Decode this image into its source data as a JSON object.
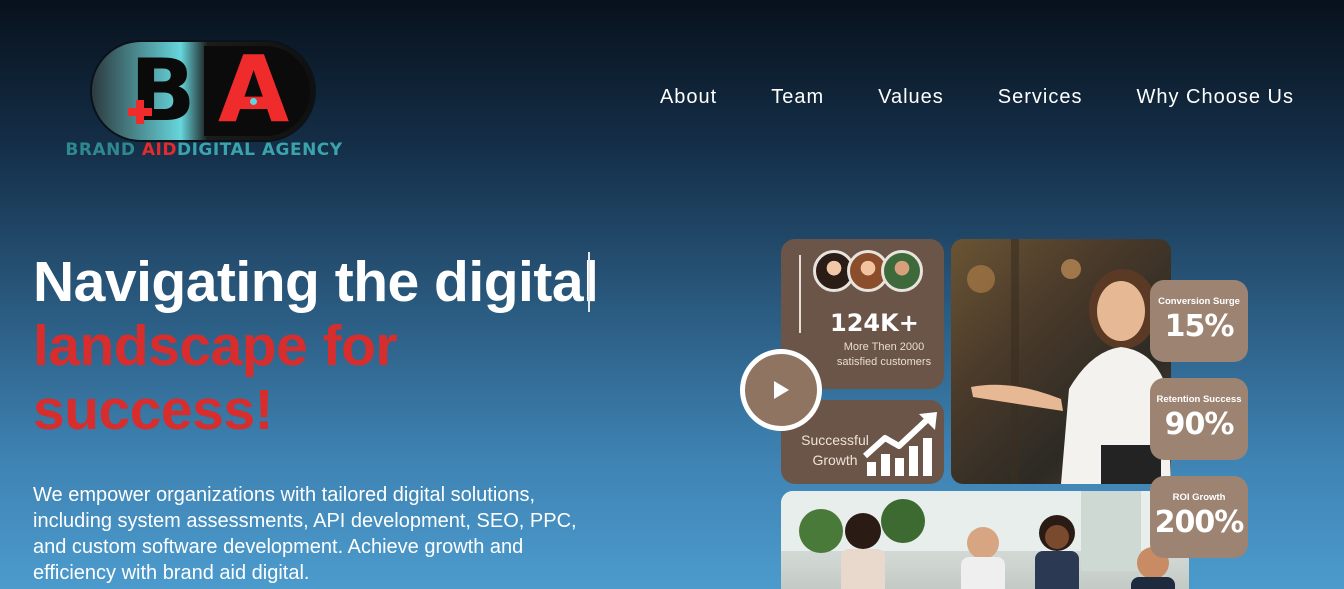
{
  "logo": {
    "letter_b": "B",
    "letter_a": "A",
    "text_part1": "BRAND",
    "text_part2": "AID",
    "text_part3": "DIGITAL AGENCY"
  },
  "nav": {
    "items": [
      {
        "label": "About"
      },
      {
        "label": "Team"
      },
      {
        "label": "Values"
      },
      {
        "label": "Services"
      },
      {
        "label": "Why Choose Us"
      }
    ]
  },
  "hero": {
    "title_line1": "Navigating the digital",
    "title_line2": "landscape for",
    "title_line3": "success!",
    "description": "We empower organizations with tailored digital solutions, including system assessments, API development, SEO, PPC, and custom software development. Achieve growth and efficiency with brand aid digital."
  },
  "stats": {
    "customers_value": "124K+",
    "customers_caption": "More Then 2000 satisfied customers",
    "growth_label": "Successful Growth",
    "badges": [
      {
        "label": "Conversion Surge",
        "value": "15%"
      },
      {
        "label": "Retention Success",
        "value": "90%"
      },
      {
        "label": "ROI Growth",
        "value": "200%"
      }
    ]
  },
  "icons": {
    "play": "play-icon",
    "growth": "growth-chart-icon"
  },
  "colors": {
    "accent_red": "#d82d2d",
    "card_brown": "#6b5448",
    "badge_tan": "#9d8472",
    "logo_teal": "#62d4dd"
  }
}
